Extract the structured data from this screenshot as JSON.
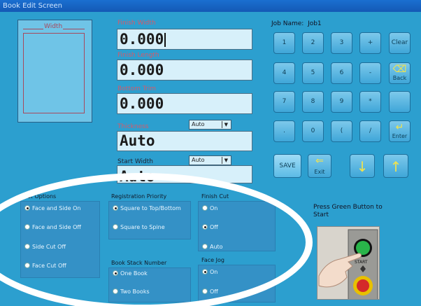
{
  "window": {
    "title": "Book Edit Screen"
  },
  "preview": {
    "width_label": "Width"
  },
  "fields": {
    "finish_width": {
      "label": "Finish Width",
      "value": "0.000"
    },
    "finish_length": {
      "label": "Finish Length",
      "value": "0.000"
    },
    "bottom_trim": {
      "label": "Bottom Trim",
      "value": "0.000"
    },
    "thickness": {
      "label": "Thickness",
      "value": "Auto",
      "mode": "Auto"
    },
    "start_width": {
      "label": "Start Width",
      "value": "Auto",
      "mode": "Auto"
    }
  },
  "job": {
    "label": "Job Name:",
    "value": "Job1"
  },
  "keypad": {
    "keys": [
      "1",
      "2",
      "3",
      "+",
      "Clear",
      "4",
      "5",
      "6",
      "-",
      "Back",
      "7",
      "8",
      "9",
      "*",
      "",
      ".",
      "0",
      "(",
      "/",
      "Enter"
    ]
  },
  "actions": {
    "save": "SAVE",
    "exit": "Exit"
  },
  "cut_options": {
    "title": "Cut Options",
    "options": [
      "Face and Side On",
      "Face and Side Off",
      "Side Cut Off",
      "Face Cut Off"
    ],
    "selected": 0
  },
  "registration_priority": {
    "title": "Registration Priority",
    "options": [
      "Square to Top/Bottom",
      "Square to Spine"
    ],
    "selected": 0
  },
  "finish_cut": {
    "title": "Finish Cut",
    "options": [
      "On",
      "Off",
      "Auto"
    ],
    "selected": 1
  },
  "book_stack": {
    "title": "Book Stack Number",
    "options": [
      "One Book",
      "Two Books"
    ],
    "selected": 0
  },
  "face_jog": {
    "title": "Face Jog",
    "options": [
      "On",
      "Off"
    ],
    "selected": 0
  },
  "start": {
    "instruction": "Press Green Button to Start",
    "button_label": "START"
  },
  "colors": {
    "background": "#2c9fcf",
    "field": "#d7f0fa",
    "label_red": "#d55a6a",
    "arrow_yellow": "#f2e34c"
  }
}
